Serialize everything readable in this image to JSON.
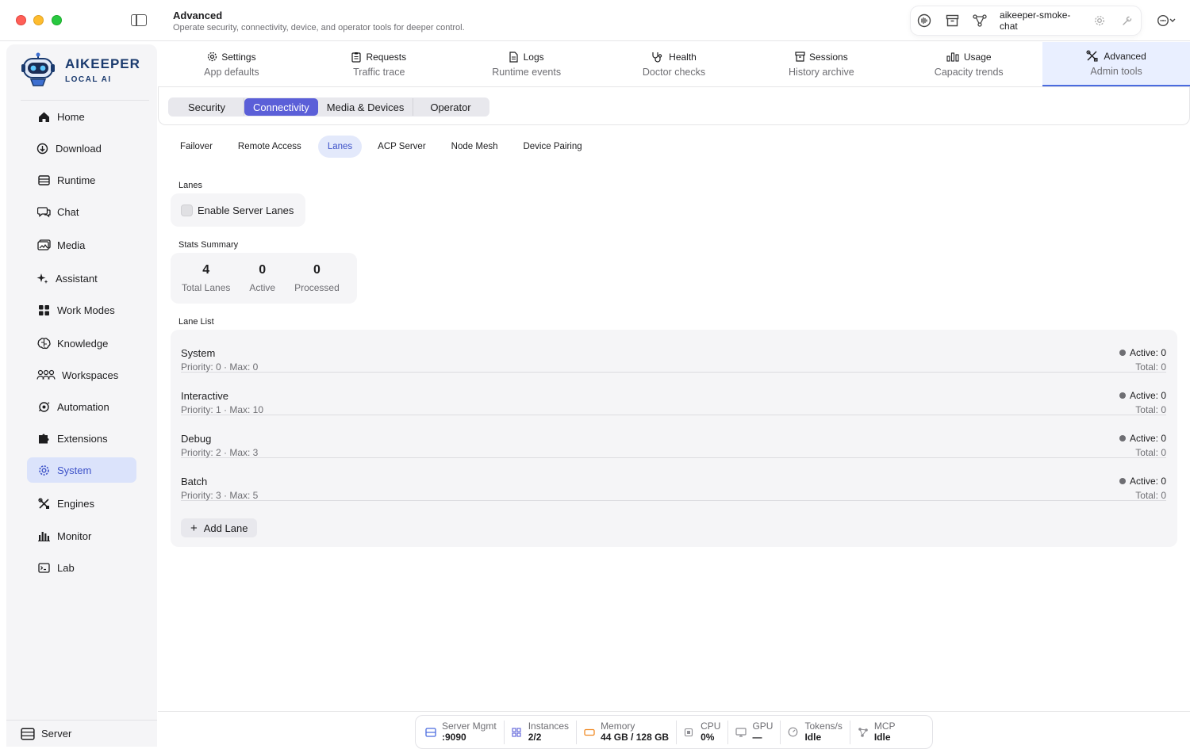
{
  "header": {
    "title": "Advanced",
    "subtitle": "Operate security, connectivity, device, and operator tools for deeper control."
  },
  "toolbar": {
    "user": "aikeeper-smoke-chat"
  },
  "brand": {
    "name": "AIKEEPER",
    "tagline": "LOCAL AI"
  },
  "sidebar": {
    "items": [
      {
        "label": "Home",
        "icon": "home-icon"
      },
      {
        "label": "Download",
        "icon": "download-icon"
      },
      {
        "label": "Runtime",
        "icon": "runtime-icon"
      },
      {
        "label": "Chat",
        "icon": "chat-icon"
      },
      {
        "label": "Media",
        "icon": "media-icon"
      },
      {
        "label": "Assistant",
        "icon": "sparkle-icon"
      },
      {
        "label": "Work Modes",
        "icon": "grid-icon"
      },
      {
        "label": "Knowledge",
        "icon": "brain-icon"
      },
      {
        "label": "Workspaces",
        "icon": "people-icon"
      },
      {
        "label": "Automation",
        "icon": "automation-icon"
      },
      {
        "label": "Extensions",
        "icon": "puzzle-icon"
      },
      {
        "label": "System",
        "icon": "gear-icon"
      },
      {
        "label": "Engines",
        "icon": "tools-icon"
      },
      {
        "label": "Monitor",
        "icon": "bar-chart-icon"
      },
      {
        "label": "Lab",
        "icon": "terminal-icon"
      }
    ],
    "active": "System",
    "footer": "Server"
  },
  "main_tabs": [
    {
      "label": "Settings",
      "sub": "App defaults",
      "icon": "gear-icon"
    },
    {
      "label": "Requests",
      "sub": "Traffic trace",
      "icon": "clipboard-icon"
    },
    {
      "label": "Logs",
      "sub": "Runtime events",
      "icon": "document-icon"
    },
    {
      "label": "Health",
      "sub": "Doctor checks",
      "icon": "stethoscope-icon"
    },
    {
      "label": "Sessions",
      "sub": "History archive",
      "icon": "archive-icon"
    },
    {
      "label": "Usage",
      "sub": "Capacity trends",
      "icon": "bar-chart-icon"
    },
    {
      "label": "Advanced",
      "sub": "Admin tools",
      "icon": "tools-icon"
    }
  ],
  "segments": [
    "Security",
    "Connectivity",
    "Media & Devices",
    "Operator"
  ],
  "active_segment": "Connectivity",
  "pills": [
    "Failover",
    "Remote Access",
    "Lanes",
    "ACP Server",
    "Node Mesh",
    "Device Pairing"
  ],
  "active_pill": "Lanes",
  "lanes_section": {
    "label": "Lanes",
    "toggle_label": "Enable Server Lanes",
    "toggle_checked": false
  },
  "stats": {
    "label": "Stats Summary",
    "items": [
      {
        "value": "4",
        "label": "Total Lanes"
      },
      {
        "value": "0",
        "label": "Active"
      },
      {
        "value": "0",
        "label": "Processed"
      }
    ]
  },
  "lane_list": {
    "label": "Lane List",
    "lanes": [
      {
        "name": "System",
        "meta": "Priority: 0  ·  Max: 0",
        "active": "Active: 0",
        "total": "Total: 0"
      },
      {
        "name": "Interactive",
        "meta": "Priority: 1  ·  Max: 10",
        "active": "Active: 0",
        "total": "Total: 0"
      },
      {
        "name": "Debug",
        "meta": "Priority: 2  ·  Max: 3",
        "active": "Active: 0",
        "total": "Total: 0"
      },
      {
        "name": "Batch",
        "meta": "Priority: 3  ·  Max: 5",
        "active": "Active: 0",
        "total": "Total: 0"
      }
    ],
    "add_label": "Add Lane"
  },
  "status_bar": [
    {
      "label": "Server Mgmt",
      "value": ":9090",
      "icon": "server-icon",
      "color": "#4a6bdf"
    },
    {
      "label": "Instances",
      "value": "2/2",
      "icon": "grid-icon",
      "color": "#5b5fd8"
    },
    {
      "label": "Memory",
      "value": "44 GB / 128 GB",
      "icon": "memory-icon",
      "color": "#f08a24"
    },
    {
      "label": "CPU",
      "value": "0%",
      "icon": "cpu-icon",
      "color": "#8e8e93"
    },
    {
      "label": "GPU",
      "value": "—",
      "icon": "monitor-icon",
      "color": "#8e8e93"
    },
    {
      "label": "Tokens/s",
      "value": "Idle",
      "icon": "gauge-icon",
      "color": "#8e8e93"
    },
    {
      "label": "MCP",
      "value": "Idle",
      "icon": "network-icon",
      "color": "#8e8e93"
    }
  ]
}
